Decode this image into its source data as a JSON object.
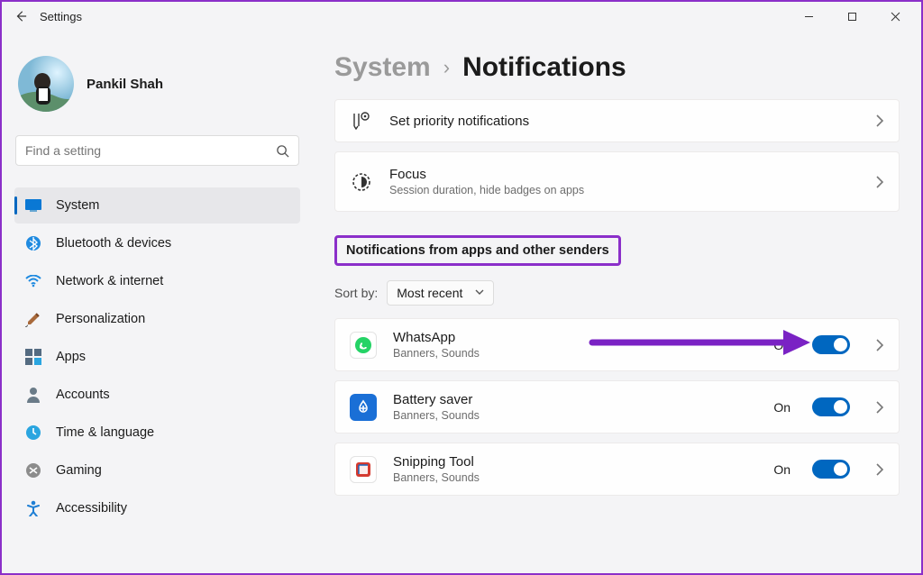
{
  "window": {
    "title": "Settings"
  },
  "profile": {
    "name": "Pankil Shah"
  },
  "search": {
    "placeholder": "Find a setting"
  },
  "sidebar": {
    "items": [
      {
        "id": "system",
        "label": "System",
        "selected": true
      },
      {
        "id": "bluetooth",
        "label": "Bluetooth & devices"
      },
      {
        "id": "network",
        "label": "Network & internet"
      },
      {
        "id": "personalization",
        "label": "Personalization"
      },
      {
        "id": "apps",
        "label": "Apps"
      },
      {
        "id": "accounts",
        "label": "Accounts"
      },
      {
        "id": "time",
        "label": "Time & language"
      },
      {
        "id": "gaming",
        "label": "Gaming"
      },
      {
        "id": "accessibility",
        "label": "Accessibility"
      }
    ]
  },
  "breadcrumb": {
    "parent": "System",
    "current": "Notifications"
  },
  "cards": {
    "priority": {
      "title": "Set priority notifications"
    },
    "focus": {
      "title": "Focus",
      "sub": "Session duration, hide badges on apps"
    }
  },
  "section": {
    "heading": "Notifications from apps and other senders",
    "sort_label": "Sort by:",
    "sort_value": "Most recent"
  },
  "apps": [
    {
      "name": "WhatsApp",
      "sub": "Banners, Sounds",
      "state": "On",
      "icon_bg": "#1fa855"
    },
    {
      "name": "Battery saver",
      "sub": "Banners, Sounds",
      "state": "On",
      "icon_bg": "#1a6fd6"
    },
    {
      "name": "Snipping Tool",
      "sub": "Banners, Sounds",
      "state": "On",
      "icon_bg": "#d43a2f"
    }
  ]
}
